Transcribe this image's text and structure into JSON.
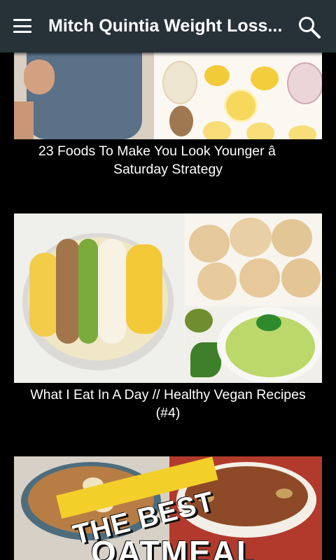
{
  "appbar": {
    "title": "Mitch Quintia Weight Loss...",
    "menu_icon": "hamburger-menu-icon",
    "search_icon": "search-icon",
    "background": "#263238"
  },
  "feed": {
    "items": [
      {
        "caption": "23 Foods To Make You Look Younger â Saturday Strategy"
      },
      {
        "caption": "What I Eat In A Day // Healthy Vegan Recipes (#4)"
      },
      {
        "overlay_line1": "THE BEST",
        "overlay_line2": "OATMEAL"
      }
    ]
  }
}
